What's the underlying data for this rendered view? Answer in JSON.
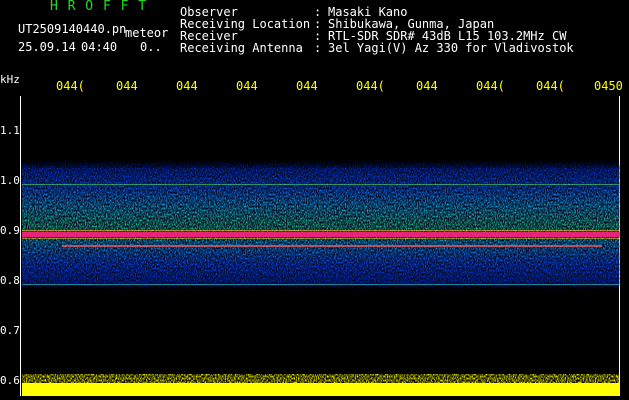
{
  "header": {
    "app_title": "H R O F F T",
    "filename": "UT2509140440.pn",
    "mode": "meteor",
    "date": "25.09.14",
    "time": "04:40",
    "counter": "0..",
    "fields": [
      {
        "label": "Observer",
        "value": "Masaki Kano"
      },
      {
        "label": "Receiving Location",
        "value": "Shibukawa, Gunma, Japan"
      },
      {
        "label": "Receiver",
        "value": "RTL-SDR SDR# 43dB L15 103.2MHz CW"
      },
      {
        "label": "Receiving Antenna",
        "value": "3el Yagi(V) Az 330 for Vladivostok"
      }
    ]
  },
  "time_axis": {
    "ticks": [
      "044(",
      "044",
      "044",
      "044",
      "044",
      "044(",
      "044",
      "044(",
      "044(",
      "0450"
    ]
  },
  "freq_axis": {
    "unit": "kHz",
    "ticks": [
      "1.1",
      "1.0",
      "0.9",
      "0.8",
      "0.7",
      "0.6"
    ]
  },
  "colors": {
    "text": "#ffffff",
    "title": "#22dd22",
    "ticks": "#ffff00",
    "background": "#000000"
  }
}
